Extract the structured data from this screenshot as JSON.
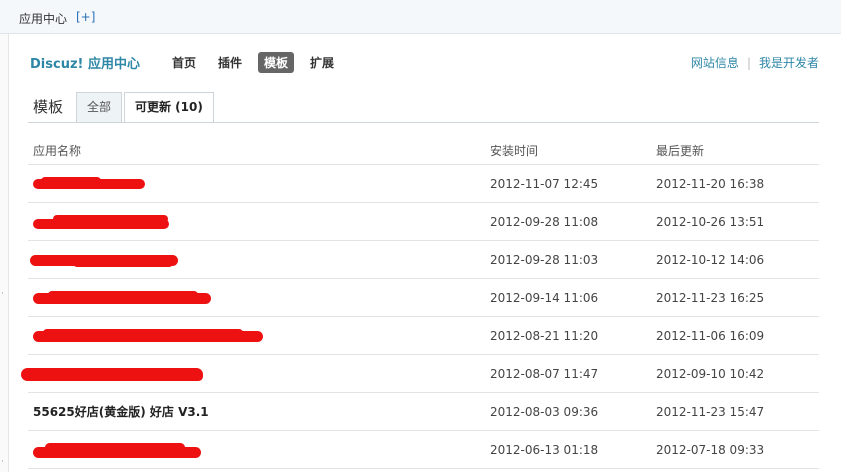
{
  "topbar": {
    "title": "应用中心",
    "add_label": "[+]"
  },
  "header": {
    "brand": "Discuz! 应用中心",
    "nav": [
      {
        "label": "首页",
        "active": false
      },
      {
        "label": "插件",
        "active": false
      },
      {
        "label": "模板",
        "active": true
      },
      {
        "label": "扩展",
        "active": false
      }
    ],
    "links": [
      "网站信息",
      "我是开发者"
    ]
  },
  "section": {
    "title": "模板",
    "tabs": [
      {
        "label": "全部",
        "active": false
      },
      {
        "label": "可更新 (10)",
        "active": true
      }
    ]
  },
  "table": {
    "columns": [
      "应用名称",
      "安装时间",
      "最后更新"
    ],
    "rows": [
      {
        "name": "",
        "redacted": true,
        "installed": "2012-11-07 12:45",
        "updated": "2012-11-20 16:38"
      },
      {
        "name": "",
        "redacted": true,
        "installed": "2012-09-28 11:08",
        "updated": "2012-10-26 13:51"
      },
      {
        "name": "",
        "redacted": true,
        "installed": "2012-09-28 11:03",
        "updated": "2012-10-12 14:06"
      },
      {
        "name": "",
        "redacted": true,
        "installed": "2012-09-14 11:06",
        "updated": "2012-11-23 16:25"
      },
      {
        "name": "",
        "redacted": true,
        "installed": "2012-08-21 11:20",
        "updated": "2012-11-06 16:09"
      },
      {
        "name": "",
        "redacted": true,
        "installed": "2012-08-07 11:47",
        "updated": "2012-09-10 10:42"
      },
      {
        "name": "55625好店(黄金版) 好店 V3.1",
        "redacted": false,
        "installed": "2012-08-03 09:36",
        "updated": "2012-11-23 15:47"
      },
      {
        "name": "",
        "redacted": true,
        "installed": "2012-06-13 01:18",
        "updated": "2012-07-18 09:33"
      }
    ]
  },
  "colors": {
    "brand": "#2e87a6",
    "redaction": "#ee1111",
    "nav_active_bg": "#666666"
  }
}
